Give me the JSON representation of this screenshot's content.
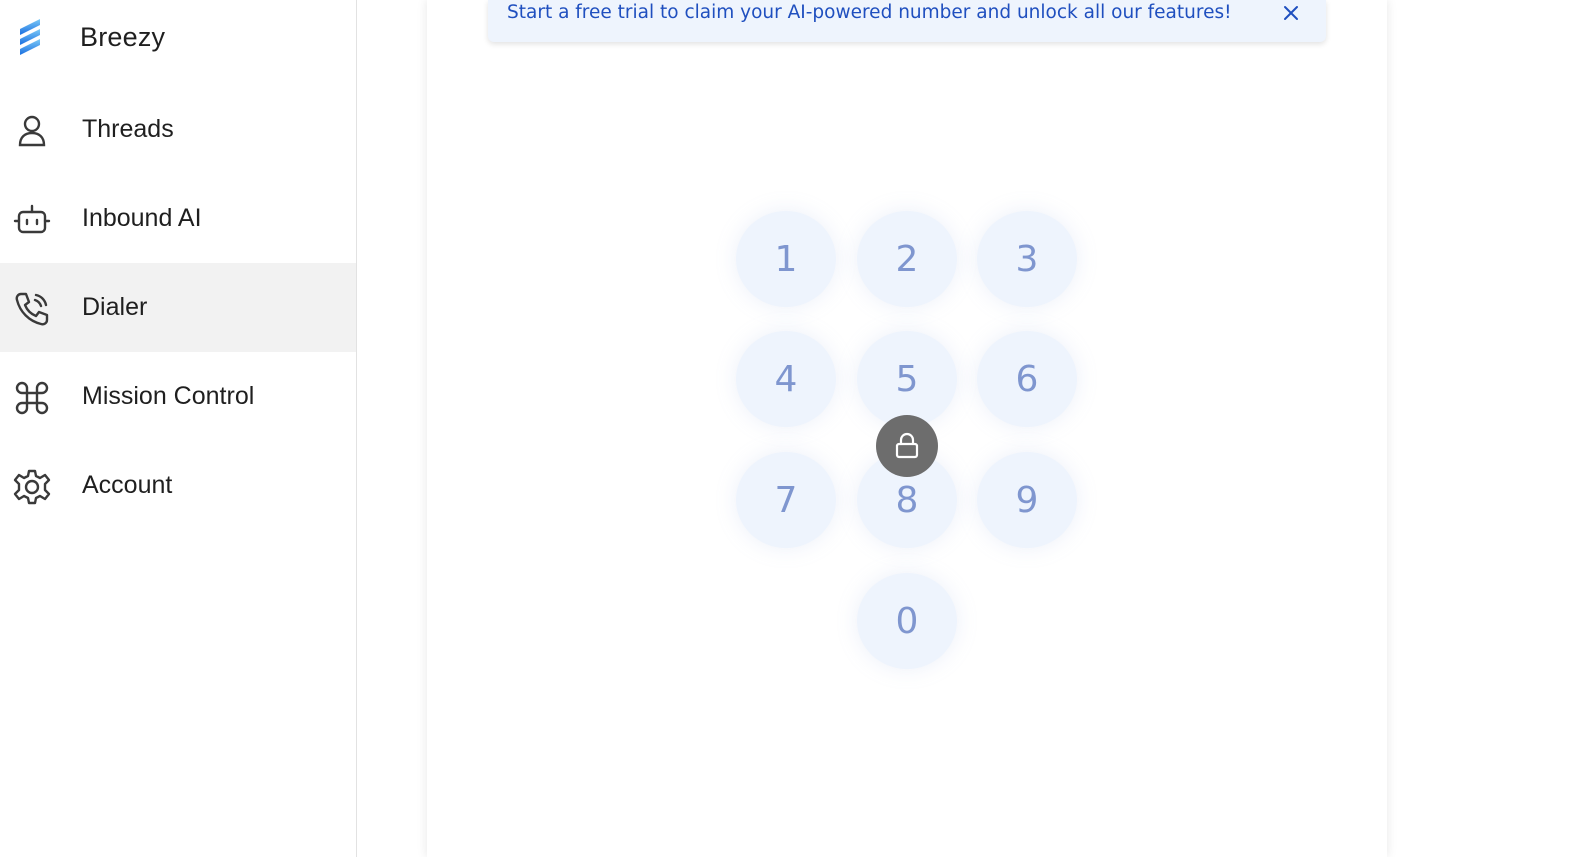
{
  "brand": {
    "name": "Breezy",
    "logo_colors": [
      "#6ec1f5",
      "#1e7be6"
    ]
  },
  "sidebar": {
    "items": [
      {
        "label": "Threads",
        "icon": "person-icon",
        "active": false
      },
      {
        "label": "Inbound AI",
        "icon": "robot-icon",
        "active": false
      },
      {
        "label": "Dialer",
        "icon": "phone-call-icon",
        "active": true
      },
      {
        "label": "Mission Control",
        "icon": "command-icon",
        "active": false
      },
      {
        "label": "Account",
        "icon": "gear-icon",
        "active": false
      }
    ]
  },
  "banner": {
    "text": "Start a free trial to claim your AI-powered number and unlock all our features!",
    "close_icon": "close-icon"
  },
  "dialpad": {
    "keys": [
      "1",
      "2",
      "3",
      "4",
      "5",
      "6",
      "7",
      "8",
      "9",
      "0"
    ],
    "locked": true,
    "lock_icon": "lock-icon"
  },
  "colors": {
    "accent": "#1f4fbf",
    "key_background": "#eef4fd",
    "key_digit": "#7f96cf",
    "active_nav": "#f2f2f2",
    "lock_badge": "#6d6d6d"
  }
}
